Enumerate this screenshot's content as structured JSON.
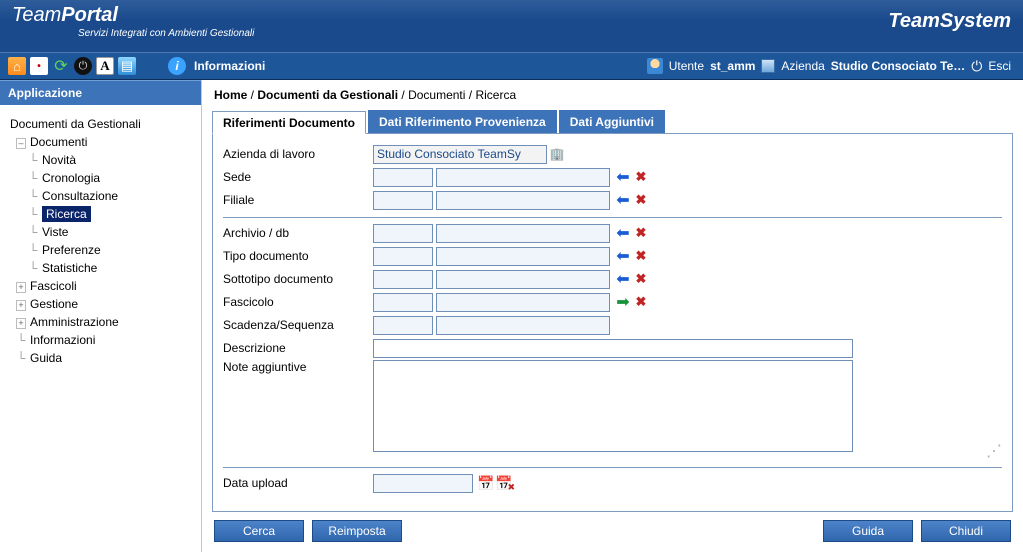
{
  "brand": {
    "left_a": "Team",
    "left_b": "Portal",
    "tagline": "Servizi Integrati con Ambienti Gestionali",
    "right": "TeamSystem"
  },
  "toolbar": {
    "info": "Informazioni",
    "user_lbl": "Utente",
    "user_val": "st_amm",
    "az_lbl": "Azienda",
    "az_val": "Studio Consociato Te…",
    "exit": "Esci"
  },
  "sidebar": {
    "title": "Applicazione",
    "root": "Documenti da Gestionali",
    "documenti": "Documenti",
    "novita": "Novità",
    "cronologia": "Cronologia",
    "consultazione": "Consultazione",
    "ricerca": "Ricerca",
    "viste": "Viste",
    "preferenze": "Preferenze",
    "statistiche": "Statistiche",
    "fascicoli": "Fascicoli",
    "gestione": "Gestione",
    "amministrazione": "Amministrazione",
    "informazioni": "Informazioni",
    "guida": "Guida"
  },
  "breadcrumb": {
    "a": "Home",
    "b": "Documenti da Gestionali",
    "c": "Documenti",
    "d": "Ricerca"
  },
  "tabs": {
    "t1": "Riferimenti Documento",
    "t2": "Dati Riferimento Provenienza",
    "t3": "Dati Aggiuntivi"
  },
  "form": {
    "azienda_lbl": "Azienda di lavoro",
    "azienda_val": "Studio Consociato TeamSy",
    "sede_lbl": "Sede",
    "filiale_lbl": "Filiale",
    "archivio_lbl": "Archivio / db",
    "tipodoc_lbl": "Tipo documento",
    "sottotipo_lbl": "Sottotipo documento",
    "fascicolo_lbl": "Fascicolo",
    "scadenza_lbl": "Scadenza/Sequenza",
    "descrizione_lbl": "Descrizione",
    "note_lbl": "Note aggiuntive",
    "dataupload_lbl": "Data upload"
  },
  "buttons": {
    "cerca": "Cerca",
    "reimposta": "Reimposta",
    "guida": "Guida",
    "chiudi": "Chiudi"
  }
}
